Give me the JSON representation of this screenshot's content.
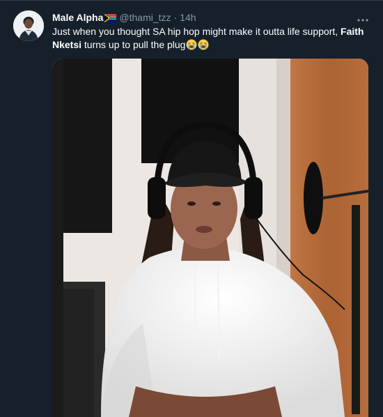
{
  "tweet": {
    "author": {
      "display_name": "Male Alpha",
      "flag_emoji": "south-africa-flag",
      "handle": "@thami_tzz"
    },
    "separator": "·",
    "time": "14h",
    "text": {
      "part1": "Just when you thought SA hip hop might make it outta life support, ",
      "bold": "Faith Nketsi",
      "part2": " turns up to pull the plug",
      "emojis": [
        "loudly-crying-face",
        "loudly-crying-face"
      ]
    },
    "media": {
      "type": "video-still",
      "description_icon": "studio-video-frame"
    }
  },
  "colors": {
    "background": "#15202b",
    "text_primary": "#ffffff",
    "text_secondary": "#8b98a5"
  }
}
